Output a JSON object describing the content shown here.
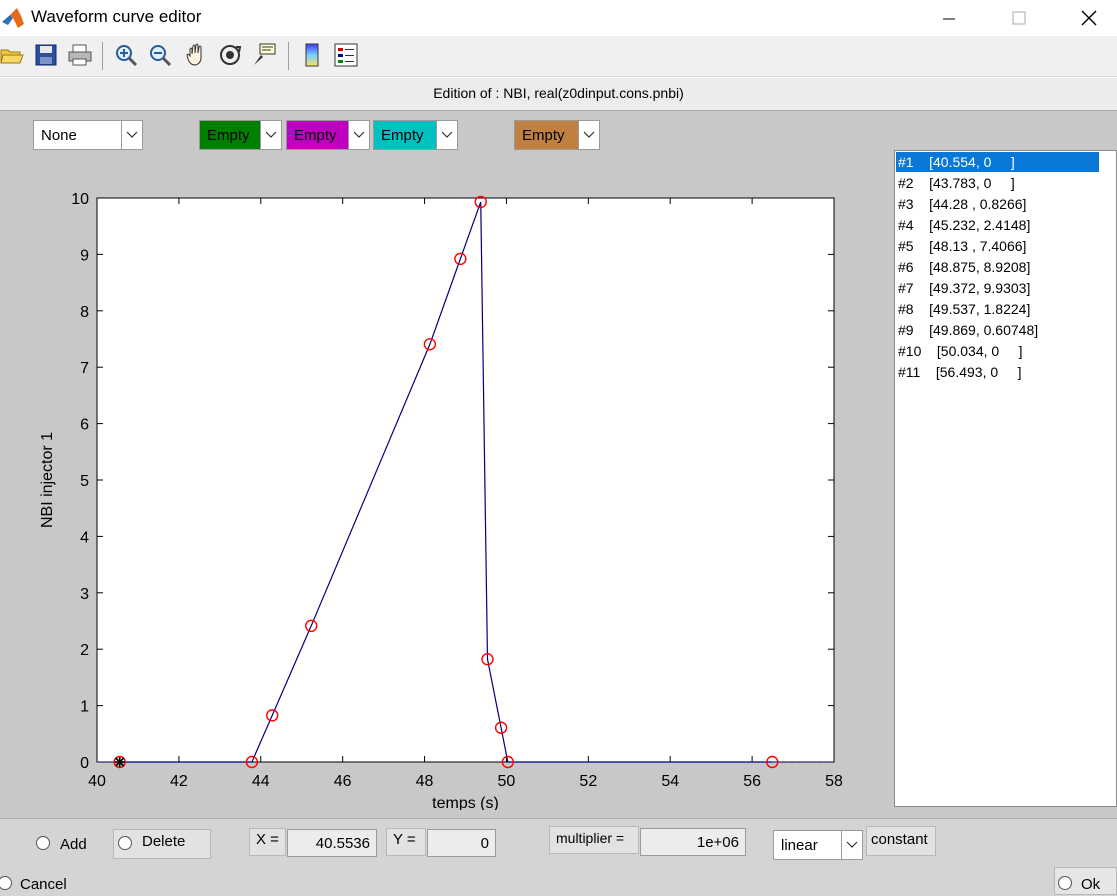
{
  "window": {
    "title": "Waveform curve editor"
  },
  "header": {
    "edition": "Edition of : NBI, real(z0dinput.cons.pnbi)"
  },
  "toolbar": {
    "icons": [
      "open-folder-icon",
      "save-icon",
      "print-icon",
      "zoom-in-icon",
      "zoom-out-icon",
      "pan-hand-icon",
      "rotate-icon",
      "data-cursor-icon",
      "colorbar-icon",
      "legend-icon"
    ]
  },
  "selectors": {
    "mode": "None",
    "swatches": [
      {
        "label": "Empty",
        "color": "#008000"
      },
      {
        "label": "Empty",
        "color": "#c000c0"
      },
      {
        "label": "Empty",
        "color": "#00c0c0"
      },
      {
        "label": "Empty",
        "color": "#c08040"
      }
    ]
  },
  "points_list": [
    "#1    [40.554, 0     ]",
    "#2    [43.783, 0     ]",
    "#3    [44.28 , 0.8266]",
    "#4    [45.232, 2.4148]",
    "#5    [48.13 , 7.4066]",
    "#6    [48.875, 8.9208]",
    "#7    [49.372, 9.9303]",
    "#8    [49.537, 1.8224]",
    "#9    [49.869, 0.60748]",
    "#10    [50.034, 0     ]",
    "#11    [56.493, 0     ]"
  ],
  "chart_data": {
    "type": "line",
    "xlabel": "temps (s)",
    "ylabel": "NBI injector 1",
    "xlim": [
      40,
      58
    ],
    "ylim": [
      0,
      10
    ],
    "xticks": [
      40,
      42,
      44,
      46,
      48,
      50,
      52,
      54,
      56,
      58
    ],
    "yticks": [
      0,
      1,
      2,
      3,
      4,
      5,
      6,
      7,
      8,
      9,
      10
    ],
    "x": [
      40.554,
      43.783,
      44.28,
      45.232,
      48.13,
      48.875,
      49.372,
      49.537,
      49.869,
      50.034,
      56.493
    ],
    "y": [
      0,
      0,
      0.8266,
      2.4148,
      7.4066,
      8.9208,
      9.9303,
      1.8224,
      0.60748,
      0,
      0
    ],
    "selected_index": 0,
    "line_color": "#000080",
    "marker_color": "#ff0000"
  },
  "controls": {
    "add_label": "Add",
    "delete_label": "Delete",
    "x_label": "X =",
    "x_value": "40.5536",
    "y_label": "Y =",
    "y_value": "0",
    "multiplier_label": "multiplier =",
    "multiplier_value": "1e+06",
    "interp": "linear",
    "constant_label": "constant",
    "cancel_label": "Cancel",
    "ok_label": "Ok"
  }
}
